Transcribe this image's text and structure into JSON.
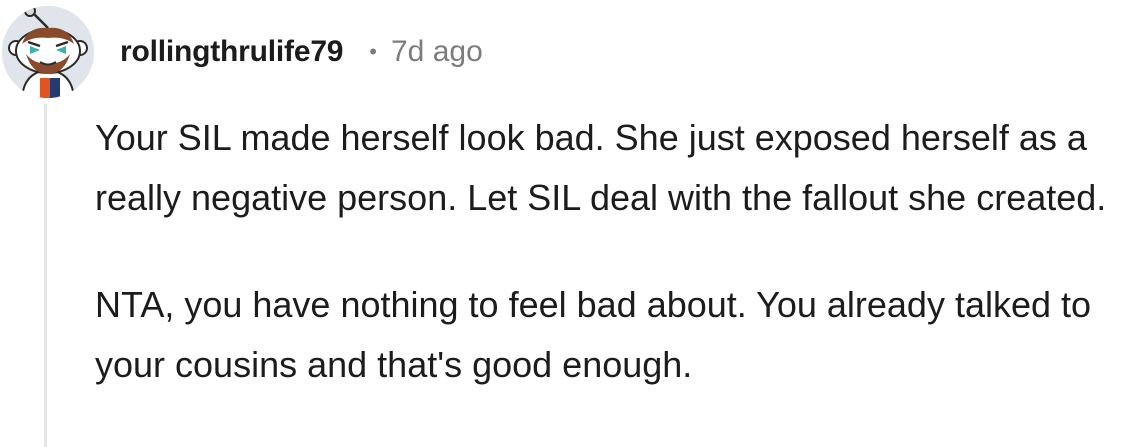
{
  "comment": {
    "author": "rollingthrulife79",
    "separator": "•",
    "age": "7d ago",
    "avatar_icon": "reddit-snoo-avatar-icon",
    "paragraphs": [
      "Your SIL made herself look bad. She just exposed herself as a really negative person. Let SIL deal with the fallout she created.",
      "NTA, you have nothing to feel bad about. You already talked to your cousins and that's good enough."
    ]
  },
  "colors": {
    "username": "#1c1c1c",
    "meta": "#7c7c7c",
    "body_text": "#1c1c1c",
    "thread_line": "#e6e6e6",
    "avatar_bg": "#dfe5ea"
  }
}
